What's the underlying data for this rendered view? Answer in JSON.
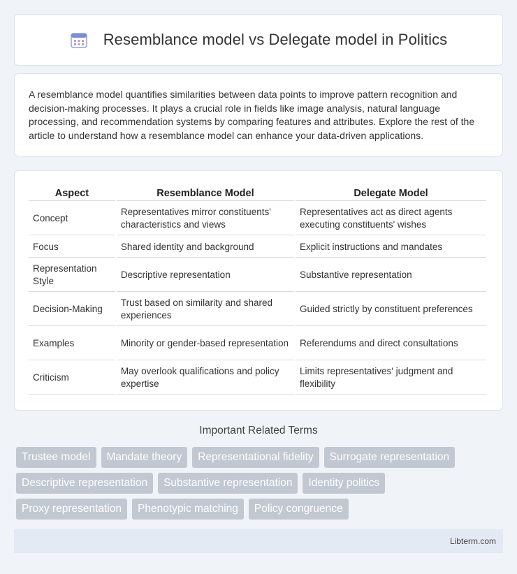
{
  "header": {
    "title": "Resemblance model vs Delegate model in Politics",
    "icon": "calendar-icon",
    "icon_color": "#7b8ed0"
  },
  "intro": {
    "text": "A resemblance model quantifies similarities between data points to improve pattern recognition and decision-making processes. It plays a crucial role in fields like image analysis, natural language processing, and recommendation systems by comparing features and attributes. Explore the rest of the article to understand how a resemblance model can enhance your data-driven applications."
  },
  "table": {
    "headers": [
      "Aspect",
      "Resemblance Model",
      "Delegate Model"
    ],
    "rows": [
      [
        "Concept",
        "Representatives mirror constituents' characteristics and views",
        "Representatives act as direct agents executing constituents' wishes"
      ],
      [
        "Focus",
        "Shared identity and background",
        "Explicit instructions and mandates"
      ],
      [
        "Representation Style",
        "Descriptive representation",
        "Substantive representation"
      ],
      [
        "Decision-Making",
        "Trust based on similarity and shared experiences",
        "Guided strictly by constituent preferences"
      ],
      [
        "Examples",
        "Minority or gender-based representation",
        "Referendums and direct consultations"
      ],
      [
        "Criticism",
        "May overlook qualifications and policy expertise",
        "Limits representatives' judgment and flexibility"
      ]
    ]
  },
  "related": {
    "title": "Important Related Terms",
    "tags": [
      [
        "Trustee model",
        "Mandate theory",
        "Representational fidelity",
        "Surrogate representation"
      ],
      [
        "Descriptive representation",
        "Substantive representation",
        "Identity politics"
      ],
      [
        "Proxy representation",
        "Phenotypic matching",
        "Policy congruence"
      ]
    ],
    "tag_color": "#c2c8d2"
  },
  "footer": {
    "brand": "Libterm.com"
  }
}
